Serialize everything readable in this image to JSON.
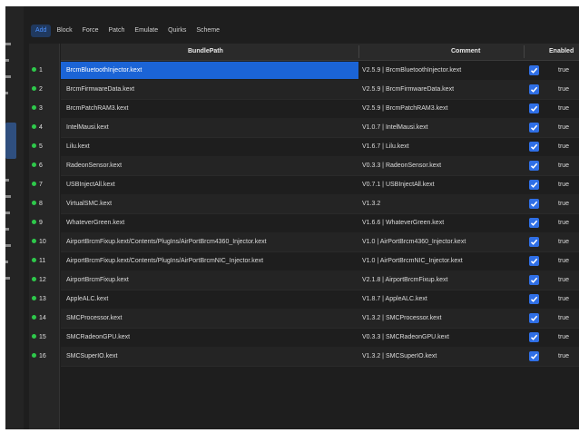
{
  "tabs": [
    "Add",
    "Block",
    "Force",
    "Patch",
    "Emulate",
    "Quirks",
    "Scheme"
  ],
  "active_tab": "Add",
  "columns": {
    "bundle_path": "BundlePath",
    "comment": "Comment",
    "enabled": "Enabled"
  },
  "colors": {
    "accent": "#1b64d6",
    "checkbox": "#2f6fe6",
    "status_dot": "#2ec94b",
    "background": "#1e1e1e"
  },
  "icons": {
    "row_status": "green-dot-icon",
    "enabled_check": "checkbox-checked-icon"
  },
  "selected_row": 1,
  "rows": [
    {
      "num": "1",
      "path": "BrcmBluetoothInjector.kext",
      "comment": "V2.5.9 | BrcmBluetoothInjector.kext",
      "enabled": "true"
    },
    {
      "num": "2",
      "path": "BrcmFirmwareData.kext",
      "comment": "V2.5.9 | BrcmFirmwareData.kext",
      "enabled": "true"
    },
    {
      "num": "3",
      "path": "BrcmPatchRAM3.kext",
      "comment": "V2.5.9 | BrcmPatchRAM3.kext",
      "enabled": "true"
    },
    {
      "num": "4",
      "path": "IntelMausi.kext",
      "comment": "V1.0.7 | IntelMausi.kext",
      "enabled": "true"
    },
    {
      "num": "5",
      "path": "Lilu.kext",
      "comment": "V1.6.7 | Lilu.kext",
      "enabled": "true"
    },
    {
      "num": "6",
      "path": "RadeonSensor.kext",
      "comment": "V0.3.3 | RadeonSensor.kext",
      "enabled": "true"
    },
    {
      "num": "7",
      "path": "USBInjectAll.kext",
      "comment": "V0.7.1 | USBInjectAll.kext",
      "enabled": "true"
    },
    {
      "num": "8",
      "path": "VirtualSMC.kext",
      "comment": "V1.3.2",
      "enabled": "true"
    },
    {
      "num": "9",
      "path": "WhateverGreen.kext",
      "comment": "V1.6.6 | WhateverGreen.kext",
      "enabled": "true"
    },
    {
      "num": "10",
      "path": "AirportBrcmFixup.kext/Contents/PlugIns/AirPortBrcm4360_Injector.kext",
      "comment": "V1.0 | AirPortBrcm4360_Injector.kext",
      "enabled": "true"
    },
    {
      "num": "11",
      "path": "AirportBrcmFixup.kext/Contents/PlugIns/AirPortBrcmNIC_Injector.kext",
      "comment": "V1.0 | AirPortBrcmNIC_Injector.kext",
      "enabled": "true"
    },
    {
      "num": "12",
      "path": "AirportBrcmFixup.kext",
      "comment": "V2.1.8 | AirportBrcmFixup.kext",
      "enabled": "true"
    },
    {
      "num": "13",
      "path": "AppleALC.kext",
      "comment": "V1.8.7 | AppleALC.kext",
      "enabled": "true"
    },
    {
      "num": "14",
      "path": "SMCProcessor.kext",
      "comment": "V1.3.2 | SMCProcessor.kext",
      "enabled": "true"
    },
    {
      "num": "15",
      "path": "SMCRadeonGPU.kext",
      "comment": "V0.3.3 | SMCRadeonGPU.kext",
      "enabled": "true"
    },
    {
      "num": "16",
      "path": "SMCSuperIO.kext",
      "comment": "V1.3.2 | SMCSuperIO.kext",
      "enabled": "true"
    }
  ]
}
